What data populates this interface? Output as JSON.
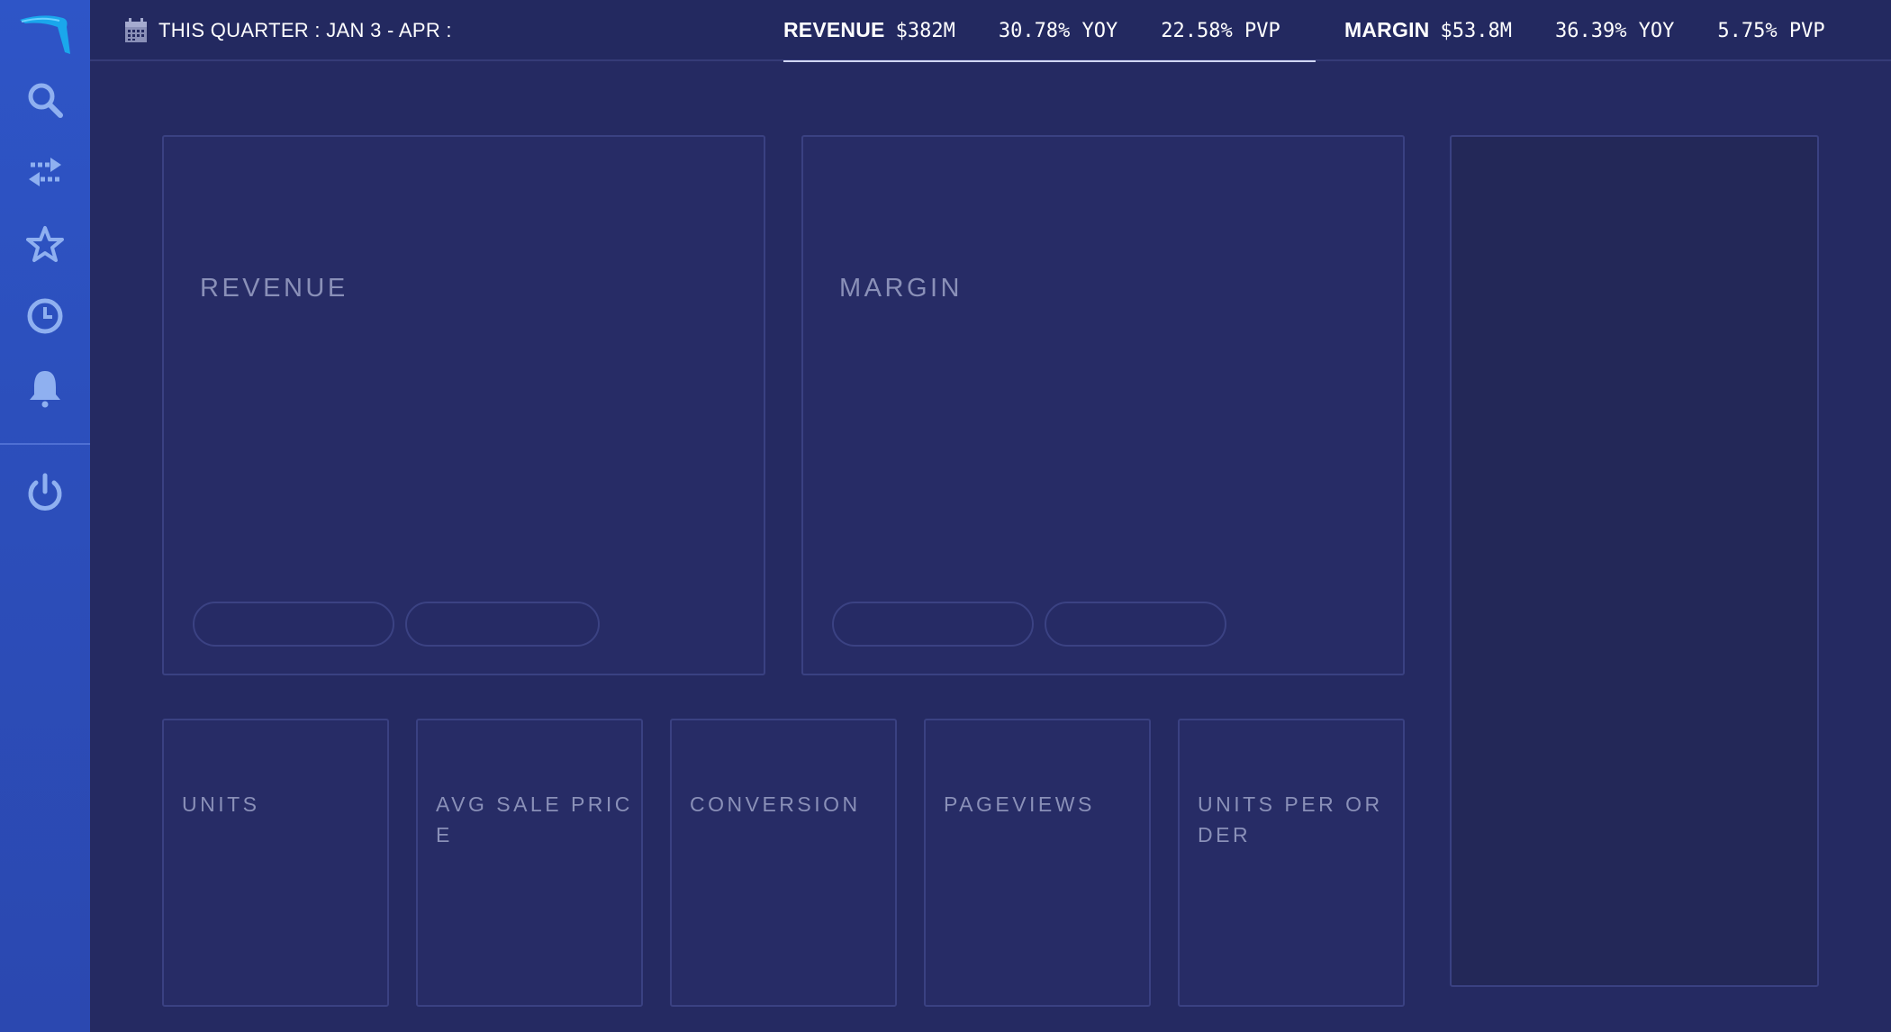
{
  "sidebar": {
    "items": [
      {
        "id": "logo",
        "icon": "boomerang-logo-icon"
      },
      {
        "id": "search",
        "icon": "search-icon"
      },
      {
        "id": "transfer",
        "icon": "swap-arrows-icon"
      },
      {
        "id": "favorites",
        "icon": "star-icon"
      },
      {
        "id": "history",
        "icon": "clock-icon"
      },
      {
        "id": "alerts",
        "icon": "bell-icon"
      },
      {
        "id": "logout",
        "icon": "power-icon"
      }
    ]
  },
  "header": {
    "date_range": "THIS QUARTER : JAN 3 - APR :",
    "revenue": {
      "label": "REVENUE",
      "value": "$382M",
      "yoy": "30.78% YOY",
      "pvp": "22.58% PVP"
    },
    "margin": {
      "label": "MARGIN",
      "value": "$53.8M",
      "yoy": "36.39% YOY",
      "pvp": "5.75% PVP"
    }
  },
  "main": {
    "big_cards": [
      {
        "title": "REVENUE"
      },
      {
        "title": "MARGIN"
      }
    ],
    "small_cards": [
      {
        "title": "UNITS"
      },
      {
        "title": "AVG SALE PRICE"
      },
      {
        "title": "CONVERSION"
      },
      {
        "title": "PAGEVIEWS"
      },
      {
        "title": "UNITS PER ORDER"
      }
    ]
  },
  "colors": {
    "background": "#252a62",
    "sidebar": "#2e55c7",
    "card_border": "#3a4182",
    "muted_text": "#8a90b8",
    "icon": "#8fb0f0"
  }
}
